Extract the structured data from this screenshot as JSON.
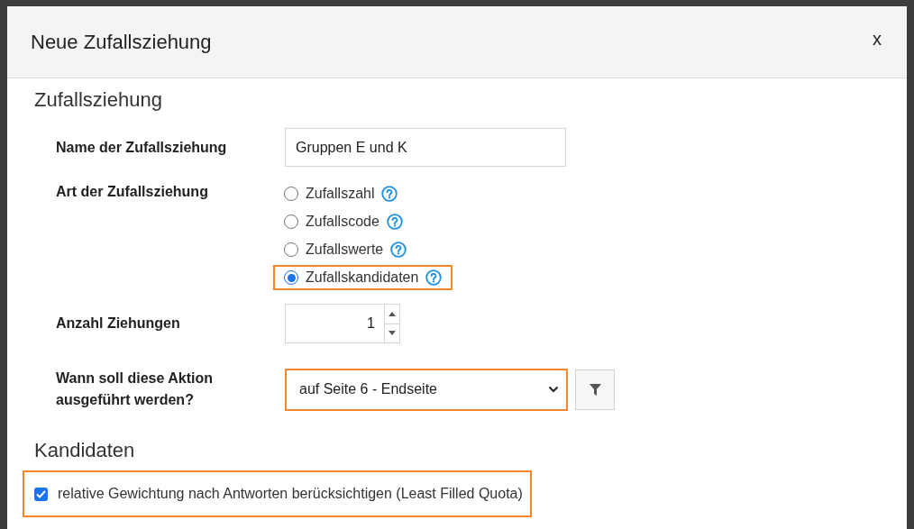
{
  "dialog": {
    "title": "Neue Zufallsziehung",
    "close_label": "x"
  },
  "section_draw": {
    "heading": "Zufallsziehung",
    "name_field": {
      "label": "Name der Zufallsziehung",
      "value": "Gruppen E und K"
    },
    "type_field": {
      "label": "Art der Zufallsziehung",
      "options": [
        {
          "label": "Zufallszahl",
          "selected": false,
          "highlighted": false
        },
        {
          "label": "Zufallscode",
          "selected": false,
          "highlighted": false
        },
        {
          "label": "Zufallswerte",
          "selected": false,
          "highlighted": false
        },
        {
          "label": "Zufallskandidaten",
          "selected": true,
          "highlighted": true
        }
      ]
    },
    "count_field": {
      "label": "Anzahl Ziehungen",
      "value": "1"
    },
    "when_field": {
      "label": "Wann soll diese Aktion ausgeführt werden?",
      "value": "auf Seite 6 - Endseite",
      "highlighted": true
    }
  },
  "section_candidates": {
    "heading": "Kandidaten",
    "checkbox": {
      "label": "relative Gewichtung nach Antworten berücksichtigen (Least Filled Quota)",
      "checked": true,
      "highlighted": true
    }
  }
}
